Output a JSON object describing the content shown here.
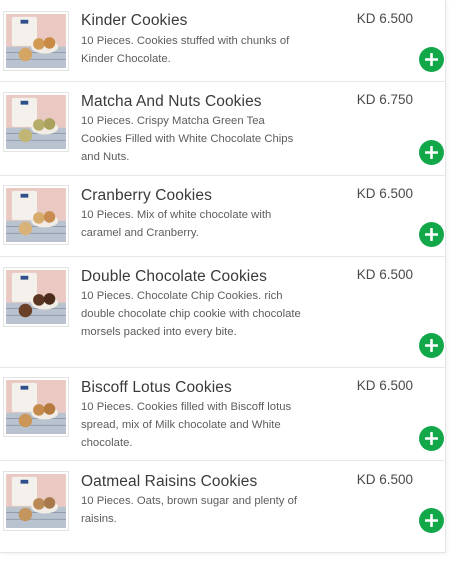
{
  "colors": {
    "add_button": "#12a84a",
    "divider": "#e8e8e8"
  },
  "items": [
    {
      "name": "Kinder Cookies",
      "description": "10 Pieces. Cookies stuffed with chunks of Kinder Chocolate.",
      "price": "KD 6.500",
      "image_icon": "cookies-box-photo",
      "add_icon": "plus-icon"
    },
    {
      "name": "Matcha And Nuts Cookies",
      "description": "10 Pieces. Crispy Matcha Green Tea Cookies Filled with White Chocolate Chips and Nuts.",
      "price": "KD 6.750",
      "image_icon": "cookies-box-photo",
      "add_icon": "plus-icon"
    },
    {
      "name": "Cranberry Cookies",
      "description": "10 Pieces. Mix of white chocolate with caramel and Cranberry.",
      "price": "KD 6.500",
      "image_icon": "cookies-box-photo",
      "add_icon": "plus-icon"
    },
    {
      "name": "Double Chocolate Cookies",
      "description": "10 Pieces. Chocolate Chip Cookies. rich double chocolate chip cookie with chocolate morsels packed into every bite.",
      "price": "KD 6.500",
      "image_icon": "cookies-box-photo",
      "add_icon": "plus-icon"
    },
    {
      "name": "Biscoff Lotus Cookies",
      "description": "10 Pieces. Cookies filled with Biscoff lotus spread, mix of Milk chocolate and White chocolate.",
      "price": "KD 6.500",
      "image_icon": "cookies-box-photo",
      "add_icon": "plus-icon"
    },
    {
      "name": "Oatmeal Raisins Cookies",
      "description": "10 Pieces. Oats, brown sugar and plenty of raisins.",
      "price": "KD 6.500",
      "image_icon": "cookies-box-photo",
      "add_icon": "plus-icon"
    }
  ]
}
